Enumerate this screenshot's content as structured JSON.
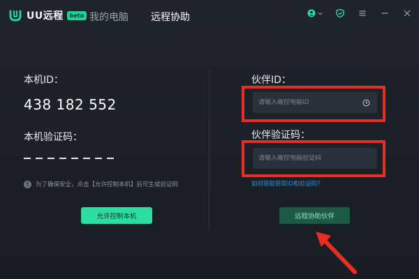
{
  "app": {
    "brand_name": "UU远程",
    "badge": "beta",
    "nav_tabs": [
      {
        "label": "我的电脑",
        "active": false
      },
      {
        "label": "远程协助",
        "active": true
      }
    ],
    "window_icons": [
      "user-icon",
      "chevron-down-icon",
      "shield-icon",
      "menu-icon",
      "minimize-icon",
      "close-icon"
    ],
    "colors": {
      "background": "#1d2229",
      "accent": "#2ddc9f",
      "accent_dark": "#1d5a46",
      "link": "#2f8fe0",
      "highlight": "#e62e22"
    }
  },
  "local": {
    "id_label": "本机ID：",
    "id_value": "438 182 552",
    "code_label": "本机验证码：",
    "code_value": "— — — — — — — —",
    "notice_icon": "info-icon",
    "notice": "为了确保安全，点击【允许控制本机】后可生成验证码",
    "allow_button": "允许控制本机"
  },
  "partner": {
    "id_label": "伙伴ID：",
    "id_placeholder": "请输入被控电脑ID",
    "history_icon": "history-clock-icon",
    "code_label": "伙伴验证码：",
    "code_placeholder": "请输入被控电脑验证码",
    "help_link": "如何获取获取ID和验证码？",
    "connect_button": "远程协助伙伴"
  }
}
